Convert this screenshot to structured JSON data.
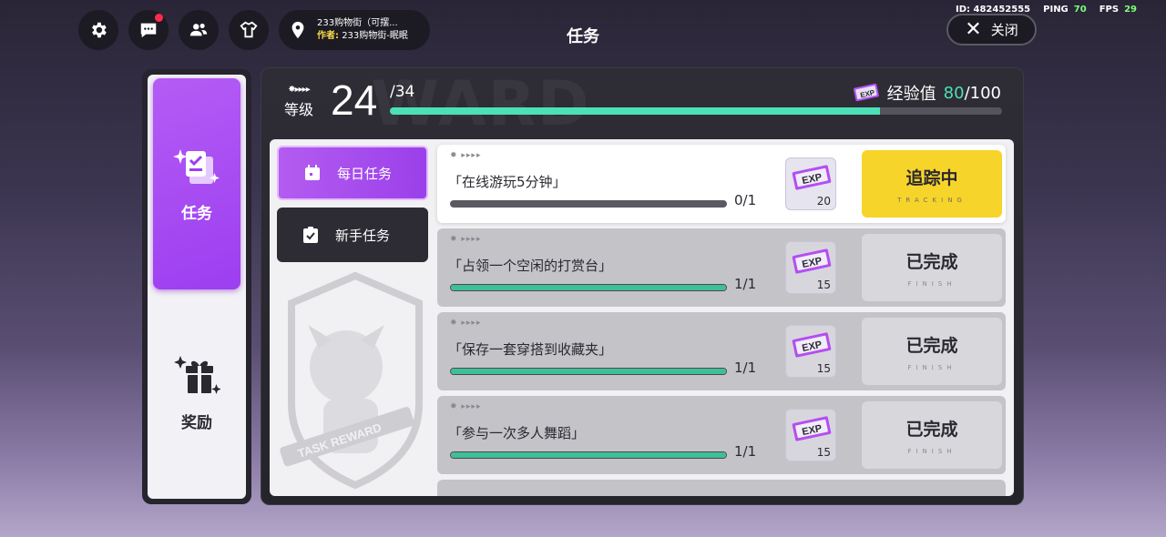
{
  "top_bar": {
    "world_name": "233购物街（可摆...",
    "author_label": "作者:",
    "author_name": "233购物街-眠眠",
    "page_title": "任务",
    "id_text": "ID: 482452555",
    "ping_label": "PING",
    "ping_value": "70",
    "fps_label": "FPS",
    "fps_value": "29",
    "close_label": "关闭",
    "icons": [
      "gear-icon",
      "chat-icon",
      "friends-icon",
      "outfit-icon",
      "location-icon"
    ]
  },
  "nav": {
    "task_label": "任务",
    "reward_label": "奖励"
  },
  "level": {
    "stars": "✸▸▸▸▸",
    "label": "等级",
    "current": "24",
    "max": "/34",
    "progress_fraction": 0.8
  },
  "exp": {
    "label": "经验值",
    "current": "80",
    "max": "/100",
    "ticket_text": "EXP"
  },
  "watermark": "WARD",
  "tabs": {
    "daily": "每日任务",
    "novice": "新手任务"
  },
  "tasks": [
    {
      "stars": "✸ ▸▸▸▸",
      "title": "「在线游玩5分钟」",
      "count": "0/1",
      "progress": 0.0,
      "exp": "20",
      "status": "追踪中",
      "status_sub": "TRACKING"
    },
    {
      "stars": "✸ ▸▸▸▸",
      "title": "「占领一个空闲的打赏台」",
      "count": "1/1",
      "progress": 1.0,
      "exp": "15",
      "status": "已完成",
      "status_sub": "FINISH"
    },
    {
      "stars": "✸ ▸▸▸▸",
      "title": "「保存一套穿搭到收藏夹」",
      "count": "1/1",
      "progress": 1.0,
      "exp": "15",
      "status": "已完成",
      "status_sub": "FINISH"
    },
    {
      "stars": "✸ ▸▸▸▸",
      "title": "「参与一次多人舞蹈」",
      "count": "1/1",
      "progress": 1.0,
      "exp": "15",
      "status": "已完成",
      "status_sub": "FINISH"
    }
  ],
  "mascot_badge_text": "TASK REWARD",
  "colors": {
    "accent_purple": "#a64cf2",
    "progress_teal": "#4de0b7",
    "tracking_yellow": "#f7d42a"
  }
}
